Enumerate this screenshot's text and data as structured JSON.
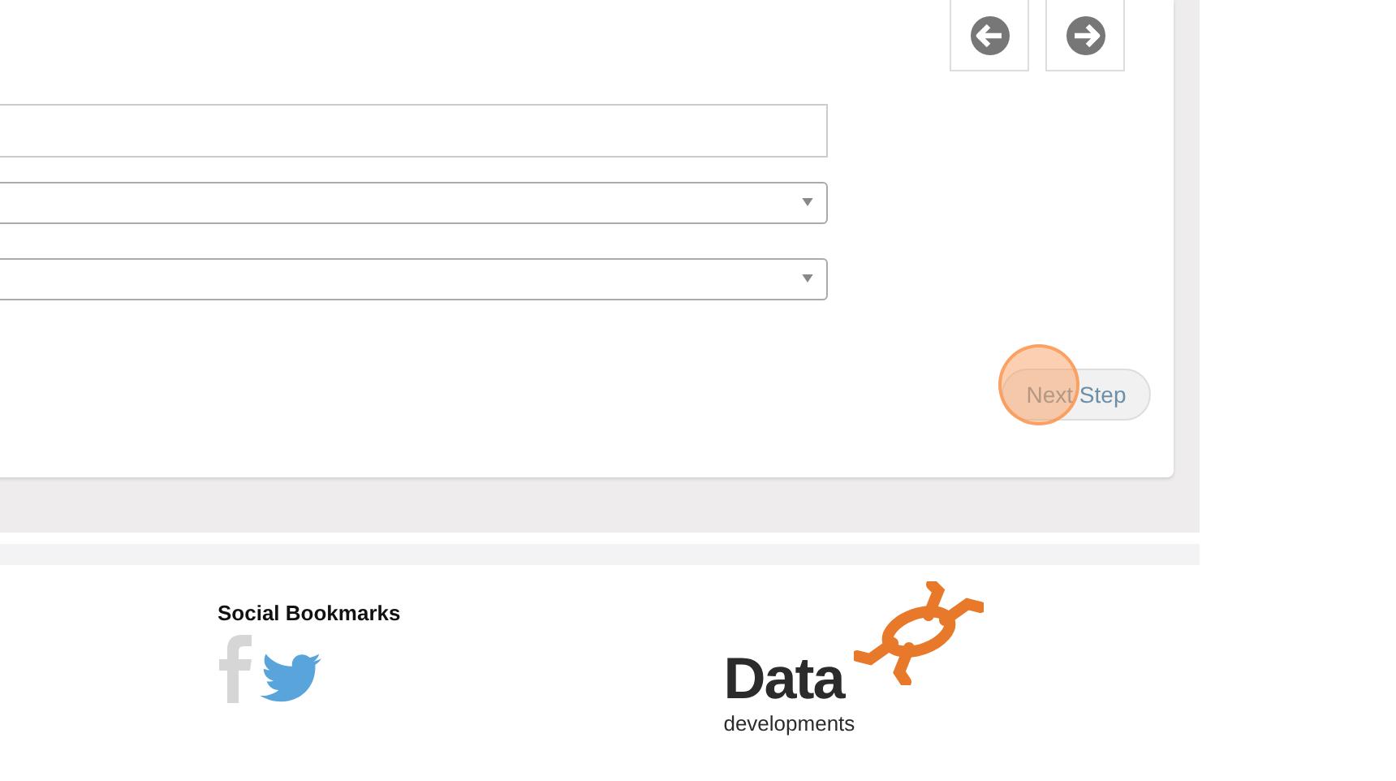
{
  "nav_buttons": [
    {
      "kind": "back"
    },
    {
      "kind": "forward"
    }
  ],
  "fields": [
    {
      "kind": "text"
    },
    {
      "kind": "select"
    },
    {
      "kind": "select"
    }
  ],
  "next_button": {
    "label": "Next Step"
  },
  "footer": {
    "social_title": "Social Bookmarks",
    "social_links": [
      {
        "kind": "facebook"
      },
      {
        "kind": "twitter"
      }
    ],
    "logo": {
      "word": "Data",
      "tagline": "developments"
    }
  }
}
